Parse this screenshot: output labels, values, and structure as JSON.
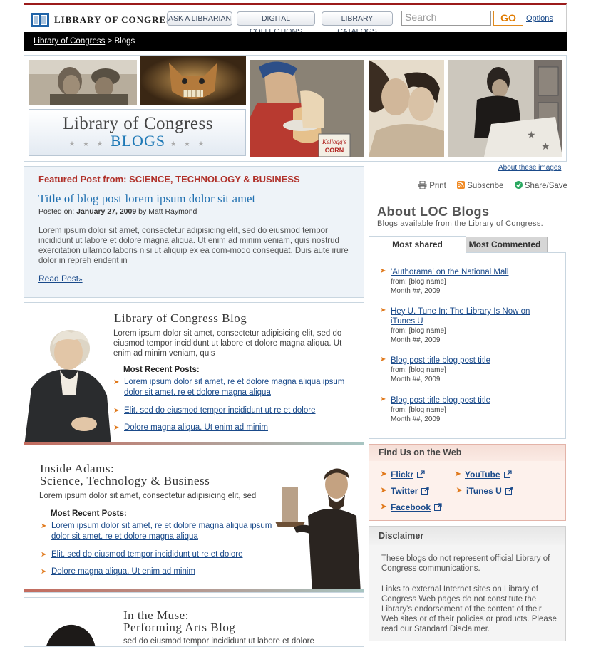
{
  "header": {
    "logo_text": "LIBRARY OF CONGRESS",
    "buttons": [
      "ASK A LIBRARIAN",
      "DIGITAL COLLECTIONS",
      "LIBRARY CATALOGS"
    ],
    "search_placeholder": "Search",
    "go_label": "GO",
    "options_label": "Options"
  },
  "breadcrumb": {
    "root": "Library of Congress",
    "separator": " > ",
    "current": "Blogs"
  },
  "banner": {
    "title_main": "Library of Congress",
    "title_blogs": "BLOGS",
    "stars_left": "★ ★ ★",
    "stars_right": "★ ★ ★",
    "kellogg_text": "Kellogg's",
    "kellogg_sub": "CORN"
  },
  "about_images": "About these images",
  "featured": {
    "label": "Featured Post from: SCIENCE, TECHNOLOGY & BUSINESS",
    "title": "Title of blog post lorem ipsum dolor sit amet",
    "posted_prefix": "Posted on: ",
    "date": "January 27, 2009",
    "by": " by Matt Raymond",
    "body": "Lorem ipsum dolor sit amet, consectetur adipisicing elit, sed do eiusmod tempor incididunt ut labore et dolore magna aliqua. Ut enim ad minim veniam, quis nostrud exercitation ullamco laboris nisi ut aliquip ex ea com-modo consequat. Duis aute irure dolor in repreh enderit in",
    "read_post": "Read Post",
    "read_arrow": "»"
  },
  "blogs": [
    {
      "title": "Library of Congress Blog",
      "desc": "Lorem ipsum dolor sit amet, consectetur adipisicing elit, sed do eiusmod tempor incididunt ut labore et dolore magna aliqua. Ut enim ad minim veniam, quis",
      "recent_label": "Most Recent Posts:",
      "posts": [
        "Lorem ipsum dolor sit amet, re et dolore magna aliqua ipsum dolor sit amet, re et dolore magna aliqua",
        "Elit, sed do eiusmod tempor incididunt ut re et dolore",
        "Dolore magna aliqua. Ut enim ad minim"
      ]
    },
    {
      "title_line1": "Inside Adams:",
      "title_line2": "Science, Technology & Business",
      "desc": "Lorem ipsum dolor sit amet, consectetur adipisicing elit, sed",
      "recent_label": "Most Recent Posts:",
      "posts": [
        "Lorem ipsum dolor sit amet, re et dolore magna aliqua ipsum dolor sit amet, re et dolore magna aliqua",
        "Elit, sed do eiusmod tempor incididunt ut re et dolore",
        "Dolore magna aliqua. Ut enim ad minim"
      ]
    },
    {
      "title_line1": "In the Muse:",
      "title_line2": "Performing Arts Blog",
      "desc": "sed do eiusmod tempor incididunt ut labore et dolore"
    }
  ],
  "share": {
    "print": "Print",
    "subscribe": "Subscribe",
    "share": "Share/Save"
  },
  "about_loc": {
    "title": "About LOC Blogs",
    "subtitle": "Blogs available from the Library of Congress."
  },
  "tabs": {
    "most_shared": "Most shared",
    "most_commented": "Most Commented"
  },
  "shared_items": [
    {
      "title": "'Authorama' on the National Mall",
      "from": "from: [blog name]",
      "date": "Month ##, 2009"
    },
    {
      "title": "Hey U, Tune In: The Library Is Now on iTunes U",
      "from": "from: [blog name]",
      "date": "Month ##, 2009"
    },
    {
      "title": "Blog post title blog post title",
      "from": "from: [blog name]",
      "date": "Month ##, 2009"
    },
    {
      "title": "Blog post title blog post title",
      "from": "from: [blog name]",
      "date": "Month ##, 2009"
    }
  ],
  "find_us": {
    "header": "Find Us on the Web",
    "links": [
      "Flickr",
      "YouTube",
      "Twitter",
      "iTunes U",
      "Facebook"
    ]
  },
  "disclaimer": {
    "header": "Disclaimer",
    "p1": "These blogs do not represent official Library of Congress communications.",
    "p2": "Links to external Internet sites on Library of Congress Web pages do not constitute the Library's endorsement of the content of their Web sites or of their policies or products. Please read our Standard Disclaimer."
  },
  "colors": {
    "accent_red": "#9b1b1b",
    "link": "#1a4a8a",
    "featured_red": "#b0312a",
    "arrow_orange": "#e0791c"
  }
}
